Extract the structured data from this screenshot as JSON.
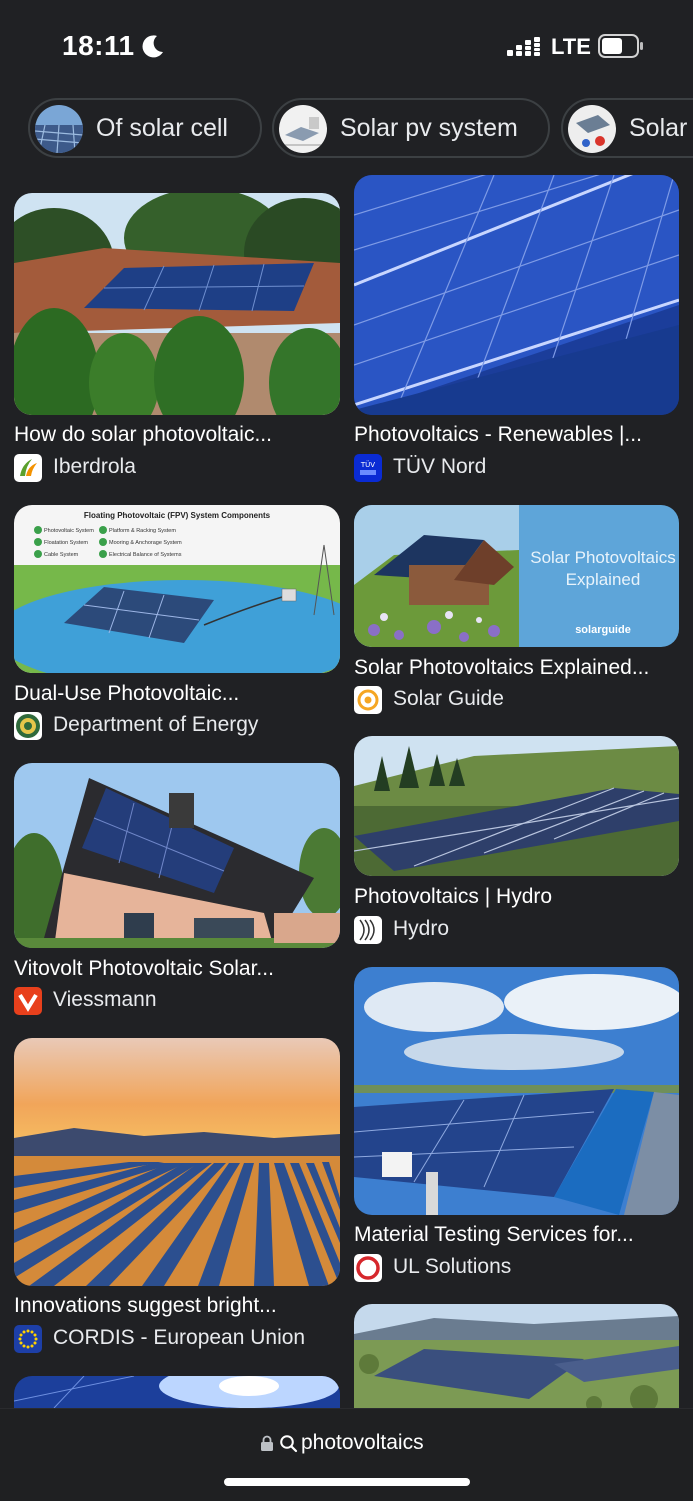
{
  "status": {
    "time": "18:11",
    "network": "LTE"
  },
  "chips": [
    {
      "label": "Of solar cell"
    },
    {
      "label": "Solar pv system"
    },
    {
      "label": "Solar"
    }
  ],
  "results": [
    {
      "title": "How do solar photovoltaic...",
      "source": "Iberdrola"
    },
    {
      "title": "Photovoltaics - Renewables |...",
      "source": "TÜV Nord"
    },
    {
      "title": "Dual-Use Photovoltaic...",
      "source": "Department of Energy",
      "image_text": {
        "heading": "Floating Photovoltaic (FPV) System Components",
        "items": [
          "Photovoltaic System",
          "Platform & Racking System",
          "Floatation System",
          "Mooring & Anchorage System",
          "Cable System",
          "Electrical Balance of Systems"
        ]
      }
    },
    {
      "title": "Solar Photovoltaics Explained...",
      "source": "Solar Guide",
      "image_text": {
        "line1": "Solar Photovoltaics",
        "line2": "Explained",
        "brand": "solarguide"
      }
    },
    {
      "title": "Vitovolt Photovoltaic Solar...",
      "source": "Viessmann"
    },
    {
      "title": "Photovoltaics | Hydro",
      "source": "Hydro"
    },
    {
      "title": "Innovations suggest bright...",
      "source": "CORDIS - European Union"
    },
    {
      "title": "Material Testing Services for...",
      "source": "UL Solutions"
    }
  ],
  "search": {
    "query": "photovoltaics"
  },
  "colors": {
    "background": "#202124",
    "text": "#e8eaed",
    "chip_border": "#3c4043"
  }
}
